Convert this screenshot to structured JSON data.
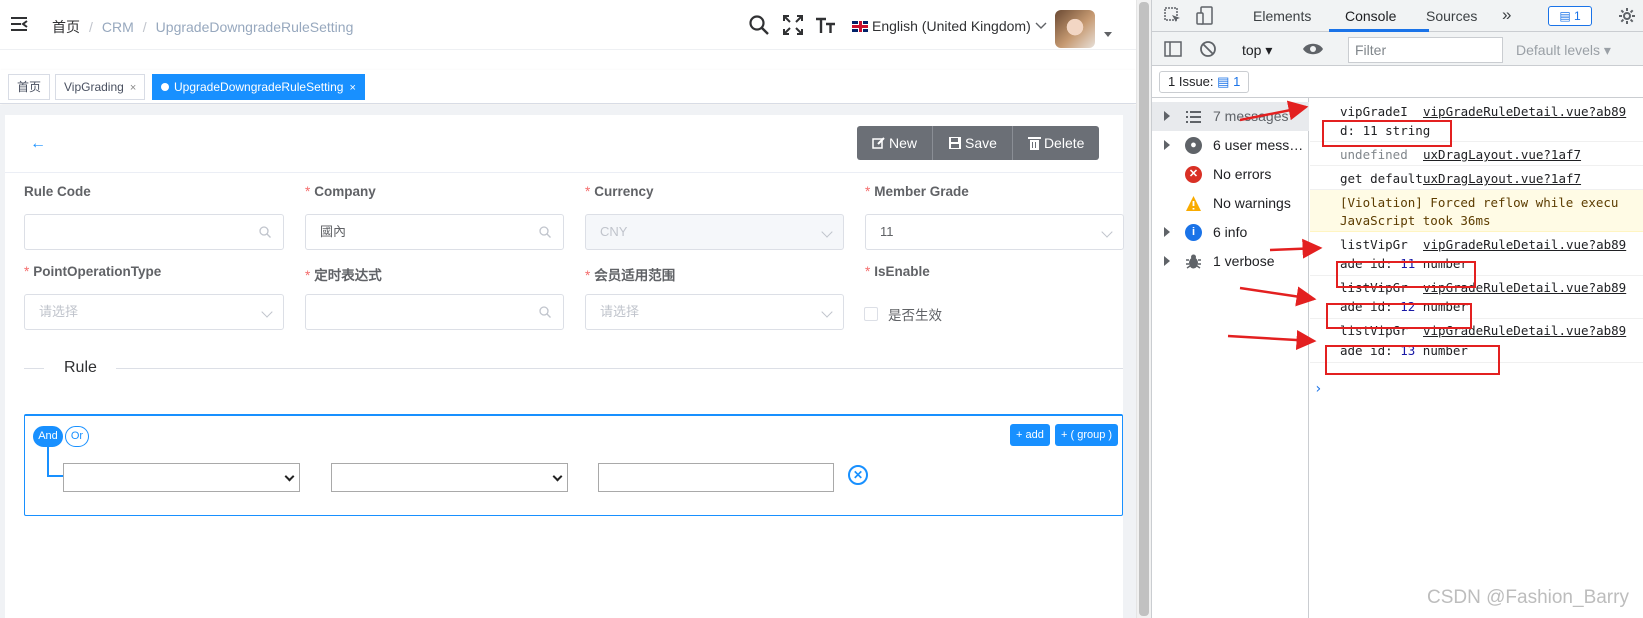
{
  "header": {
    "breadcrumb": [
      "首页",
      "CRM",
      "UpgradeDowngradeRuleSetting"
    ],
    "breadcrumb_sep": "/",
    "language": "English (United Kingdom)"
  },
  "tags": [
    {
      "label": "首页"
    },
    {
      "label": "VipGrading",
      "close": "×"
    },
    {
      "label": "UpgradeDowngradeRuleSetting",
      "close": "×",
      "active": true
    }
  ],
  "toolbar": {
    "back": "←",
    "new_label": "New",
    "save_label": "Save",
    "delete_label": "Delete"
  },
  "form": {
    "rule_code": {
      "label": "Rule Code",
      "value": ""
    },
    "company": {
      "label": "Company",
      "value": "國內"
    },
    "currency": {
      "label": "Currency",
      "value": "CNY"
    },
    "member_grade": {
      "label": "Member Grade",
      "value": "11"
    },
    "point_operation_type": {
      "label": "PointOperationType",
      "placeholder": "请选择"
    },
    "cron": {
      "label": "定时表达式",
      "value": ""
    },
    "member_scope": {
      "label": "会员适用范围",
      "placeholder": "请选择"
    },
    "is_enable": {
      "label": "IsEnable",
      "checkbox_label": "是否生效"
    },
    "required_mark": "*"
  },
  "rule_section": {
    "title": "Rule",
    "and_label": "And",
    "or_label": "Or",
    "add_label": "+ add",
    "add_group_label": "+ ( group )"
  },
  "devtools": {
    "tabs": [
      "Elements",
      "Console",
      "Sources"
    ],
    "more": "»",
    "issue_badge": "1",
    "context": "top",
    "filter_placeholder": "Filter",
    "levels": "Default levels",
    "issues_label": "1 Issue:",
    "issues_count": "1",
    "sidebar": [
      {
        "label": "7 messages",
        "icon": "list-icon"
      },
      {
        "label": "6 user mess…",
        "icon": "user-icon"
      },
      {
        "label": "No errors",
        "icon": "error-icon"
      },
      {
        "label": "No warnings",
        "icon": "warning-icon"
      },
      {
        "label": "6 info",
        "icon": "info-icon"
      },
      {
        "label": "1 verbose",
        "icon": "bug-icon"
      }
    ],
    "logs": [
      {
        "text": "vipGradeI",
        "source": "vipGradeRuleDetail.vue?ab89"
      },
      {
        "text": "d: 11 string"
      },
      {
        "text": "undefined",
        "source": "uxDragLayout.vue?1af7"
      },
      {
        "text": "get default",
        "source": "uxDragLayout.vue?1af7"
      },
      {
        "text": "[Violation] Forced reflow while execu"
      },
      {
        "text": "JavaScript took 36ms"
      },
      {
        "text": "listVipGr",
        "source": "vipGradeRuleDetail.vue?ab89"
      },
      {
        "text_prefix": "ade id: ",
        "number": "11",
        "text_suffix": " number"
      },
      {
        "text": "listVipGr",
        "source": "vipGradeRuleDetail.vue?ab89"
      },
      {
        "text_prefix": "ade id: ",
        "number": "12",
        "text_suffix": " number"
      },
      {
        "text": "listVipGr",
        "source": "vipGradeRuleDetail.vue?ab89"
      },
      {
        "text_prefix": "ade id: ",
        "number": "13",
        "text_suffix": " number"
      }
    ],
    "prompt": "›"
  },
  "watermark": "CSDN @Fashion_Barry",
  "colors": {
    "primary": "#1890ff",
    "annotation_red": "#e32020",
    "required": "#f56c6c"
  }
}
